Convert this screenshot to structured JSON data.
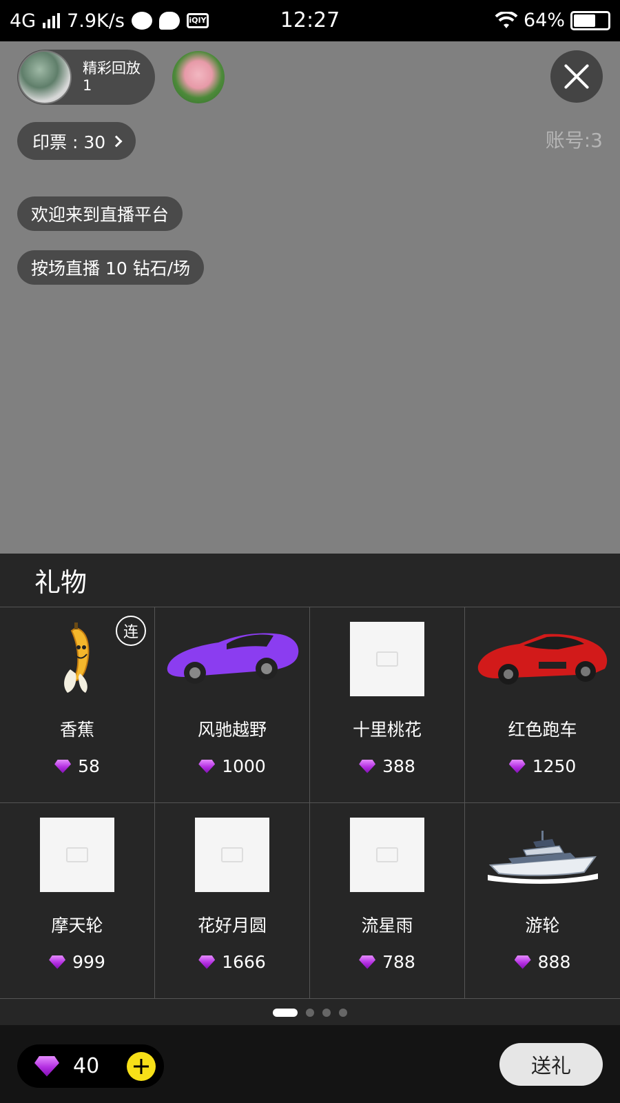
{
  "status_bar": {
    "network": "4G",
    "speed": "7.9K/s",
    "time": "12:27",
    "battery_percent": "64%",
    "battery_level": 0.64,
    "icons": [
      "signal-icon",
      "q-app-icon",
      "chat-icon",
      "iqiyi-icon",
      "wifi-icon",
      "battery-icon"
    ]
  },
  "overlay": {
    "replay": {
      "line1": "精彩回放",
      "line2": "1"
    },
    "ticket_label": "印票 : 30",
    "account": "账号:3",
    "messages": [
      "欢迎来到直播平台",
      "按场直播  10  钻石/场"
    ]
  },
  "gift_panel": {
    "title": "礼物",
    "combo_badge": "连",
    "gifts": [
      {
        "name": "香蕉",
        "price": "58",
        "image": "banana"
      },
      {
        "name": "风驰越野",
        "price": "1000",
        "image": "purple-car"
      },
      {
        "name": "十里桃花",
        "price": "388",
        "image": "placeholder"
      },
      {
        "name": "红色跑车",
        "price": "1250",
        "image": "red-car"
      },
      {
        "name": "摩天轮",
        "price": "999",
        "image": "placeholder"
      },
      {
        "name": "花好月圆",
        "price": "1666",
        "image": "placeholder"
      },
      {
        "name": "流星雨",
        "price": "788",
        "image": "placeholder"
      },
      {
        "name": "游轮",
        "price": "888",
        "image": "yacht"
      }
    ],
    "pager": {
      "pages": 4,
      "active": 1
    }
  },
  "bottom_bar": {
    "balance": "40",
    "send_label": "送礼"
  },
  "colors": {
    "stream_bg": "#808080",
    "panel_bg": "#262626",
    "add_button": "#f7e018",
    "diamond": "#b22de0"
  }
}
